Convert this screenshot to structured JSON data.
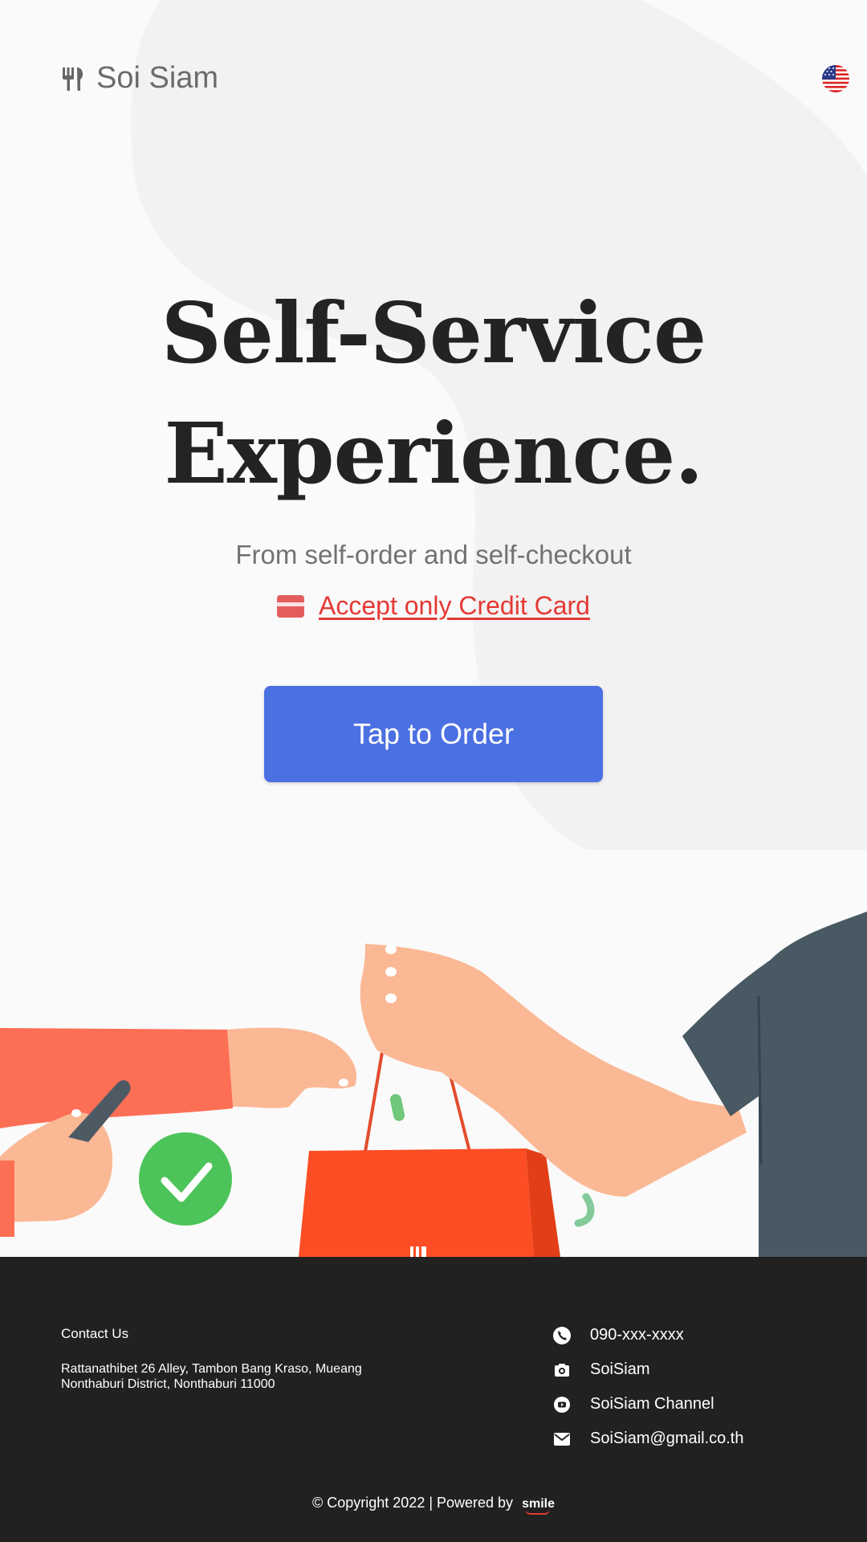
{
  "brand": {
    "name": "Soi Siam",
    "logo_icon": "utensils-icon"
  },
  "language": {
    "current": "English",
    "flag_icon": "us-flag-icon"
  },
  "hero": {
    "title_line1": "Self-Service",
    "title_line2": "Experience.",
    "subtitle": "From self-order and self-checkout",
    "payment_note": "Accept only Credit Card",
    "payment_icon": "credit-card-icon",
    "cta_label": "Tap to Order"
  },
  "illustration": {
    "subject": "hand-over-shopping-bag-illustration"
  },
  "footer": {
    "contact_title": "Contact Us",
    "address_line1": "Rattanathibet 26 Alley, Tambon Bang Kraso, Mueang",
    "address_line2": "Nonthaburi District, Nonthaburi 11000",
    "contacts": [
      {
        "icon": "phone-icon",
        "label": "090-xxx-xxxx"
      },
      {
        "icon": "instagram-icon",
        "label": "SoiSiam"
      },
      {
        "icon": "youtube-icon",
        "label": "SoiSiam Channel"
      },
      {
        "icon": "email-icon",
        "label": "SoiSiam@gmail.co.th"
      }
    ],
    "copyright": "© Copyright 2022 | Powered by",
    "powered_by": "smile"
  },
  "colors": {
    "accent": "#4b70e2",
    "warning": "#e53935",
    "footer_bg": "#212121",
    "background": "#fafafa"
  }
}
